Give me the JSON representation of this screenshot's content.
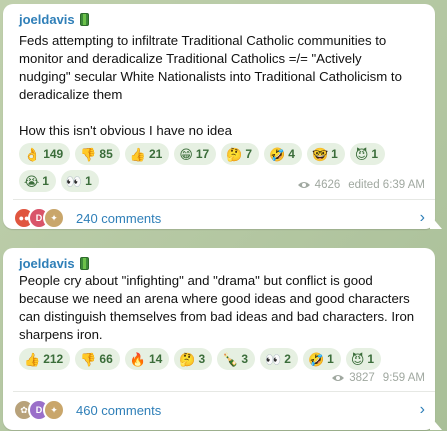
{
  "posts": [
    {
      "author": "joeldavis",
      "text_lines": [
        "Feds attempting to infiltrate Traditional Catholic communities to",
        "monitor and deradicalize Traditional Catholics =/= \"Actively",
        "nudging\" secular White Nationalists into Traditional Catholicism to",
        "deradicalize them",
        "",
        "How this isn't obvious I have no idea"
      ],
      "reactions": [
        {
          "emoji": "👌",
          "count": "149"
        },
        {
          "emoji": "👎",
          "count": "85"
        },
        {
          "emoji": "👍",
          "count": "21"
        },
        {
          "emoji": "😁",
          "count": "17"
        },
        {
          "emoji": "🤔",
          "count": "7"
        },
        {
          "emoji": "🤣",
          "count": "4"
        },
        {
          "emoji": "🤓",
          "count": "1"
        },
        {
          "emoji": "😈",
          "count": "1"
        },
        {
          "emoji": "😭",
          "count": "1"
        },
        {
          "emoji": "👀",
          "count": "1"
        }
      ],
      "views": "4626",
      "time": "edited 6:39 AM",
      "comments": "240 comments"
    },
    {
      "author": "joeldavis",
      "text_lines": [
        "People cry about \"infighting\" and \"drama\" but conflict is good",
        "because we need an arena where good ideas and good characters",
        "can distinguish themselves from bad ideas and bad characters. Iron",
        "sharpens iron."
      ],
      "reactions": [
        {
          "emoji": "👍",
          "count": "212"
        },
        {
          "emoji": "👎",
          "count": "66"
        },
        {
          "emoji": "🔥",
          "count": "14"
        },
        {
          "emoji": "🤔",
          "count": "3"
        },
        {
          "emoji": "🍾",
          "count": "3"
        },
        {
          "emoji": "👀",
          "count": "2"
        },
        {
          "emoji": "🤣",
          "count": "1"
        },
        {
          "emoji": "😈",
          "count": "1"
        }
      ],
      "views": "3827",
      "time": "9:59 AM",
      "comments": "460 comments"
    }
  ],
  "colors": {
    "accent": "#2f7fb8",
    "reaction_bg": "#e6f0e2",
    "reaction_text": "#3b6d3a",
    "meta_text": "#a0a8a0",
    "chat_bg": "#b7c8a7"
  }
}
